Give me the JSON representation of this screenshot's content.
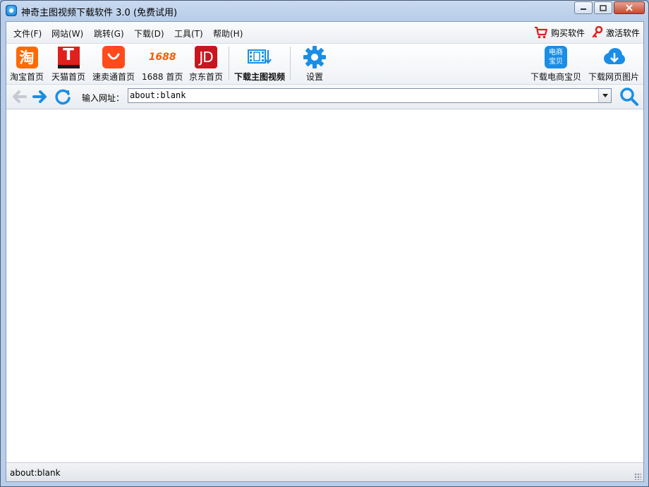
{
  "window": {
    "title": "神奇主图视频下载软件 3.0 (免费试用)"
  },
  "menu": [
    {
      "label": "文件(F)"
    },
    {
      "label": "网站(W)"
    },
    {
      "label": "跳转(G)"
    },
    {
      "label": "下载(D)"
    },
    {
      "label": "工具(T)"
    },
    {
      "label": "帮助(H)"
    }
  ],
  "menu_right": {
    "buy": "购买软件",
    "activate": "激活软件"
  },
  "toolbar": {
    "taobao": {
      "label": "淘宝首页",
      "icon_text": "淘"
    },
    "tmall": {
      "label": "天猫首页",
      "icon_text": "T"
    },
    "aliexpress": {
      "label": "速卖通首页"
    },
    "s1688": {
      "label": "1688 首页",
      "icon_text": "1688"
    },
    "jd": {
      "label": "京东首页",
      "icon_text": "JD"
    },
    "download_video": {
      "label": "下载主图视频"
    },
    "settings": {
      "label": "设置"
    },
    "download_item": {
      "label": "下载电商宝贝",
      "icon_text": "电商\n宝贝"
    },
    "download_images": {
      "label": "下载网页图片"
    }
  },
  "nav": {
    "address_label": "输入网址：",
    "address_value": "about:blank"
  },
  "status": {
    "text": "about:blank"
  },
  "colors": {
    "accent_blue": "#1a8ee6",
    "taobao": "#ff6a00",
    "tmall": "#e0201c",
    "jd": "#c9151e"
  }
}
